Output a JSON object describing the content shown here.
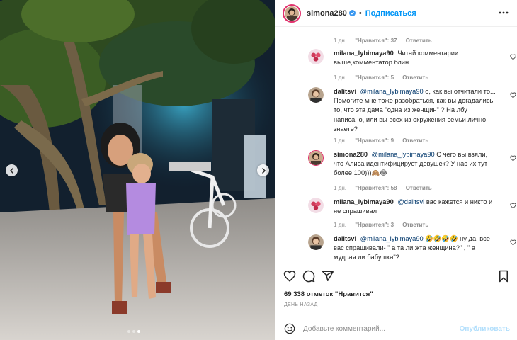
{
  "header": {
    "username": "simona280",
    "separator": "•",
    "follow_label": "Подписаться"
  },
  "comments": [
    {
      "partial": true,
      "time": "1 дн.",
      "likes": "\"Нравится\": 37",
      "reply": "Ответить"
    },
    {
      "user": "milana_lybimaya90",
      "text": "Читай комментарии выше,комментатор блин",
      "time": "1 дн.",
      "likes": "\"Нравится\": 5",
      "reply": "Ответить"
    },
    {
      "user": "dalitsvi",
      "mention": "@milana_lybimaya90",
      "text": "о, как вы отчитали то... Помогите мне тоже разобраться, как вы догадались то, что эта дама \"одна из женщин\" ? На лбу написано, или вы всех из окружения семьи лично знаете?",
      "time": "1 дн.",
      "likes": "\"Нравится\": 9",
      "reply": "Ответить"
    },
    {
      "user": "simona280",
      "mention": "@milana_lybimaya90",
      "text": "С чего вы взяли, что Алиса идентифицирует девушек? У нас их тут более 100)))🙈😂",
      "time": "1 дн.",
      "likes": "\"Нравится\": 58",
      "reply": "Ответить"
    },
    {
      "user": "milana_lybimaya90",
      "mention": "@dalitsvi",
      "text": "вас кажется и никто и не спрашивал",
      "time": "1 дн.",
      "likes": "\"Нравится\": 3",
      "reply": "Ответить"
    },
    {
      "user": "dalitsvi",
      "mention": "@milana_lybimaya90",
      "text": "🤣🤣🤣🤣 ну да, все вас спрашивали- \" а та ли жта женщина?\" , \" а мудрая ли бабушка\"?"
    }
  ],
  "likes_text": "69 338 отметок \"Нравится\"",
  "posted_text": "ДЕНЬ НАЗАД",
  "add_comment": {
    "placeholder": "Добавьте комментарий...",
    "publish_label": "Опубликовать"
  },
  "colors": {
    "link_blue": "#0095f6",
    "mention": "#00376b",
    "muted": "#8e8e8e",
    "publish_disabled": "#b2dffc"
  },
  "icons": [
    "more-icon",
    "heart-icon",
    "comment-icon",
    "share-icon",
    "save-icon",
    "emoji-icon",
    "chevron-left-icon",
    "chevron-right-icon",
    "verified-icon"
  ],
  "carousel": {
    "slides": 3,
    "active_slide": 3
  }
}
